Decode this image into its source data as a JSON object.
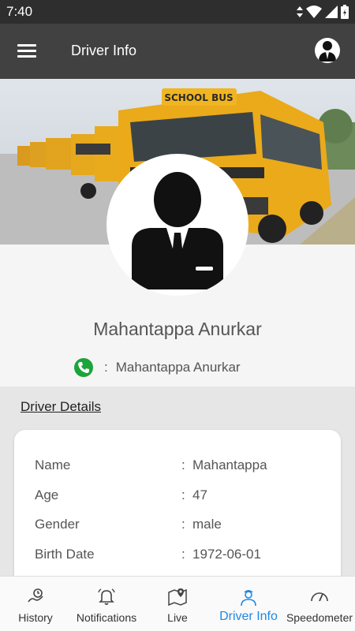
{
  "status_bar": {
    "time": "7:40",
    "icons": [
      "data-arrows-icon",
      "wifi-icon",
      "signal-icon",
      "battery-icon"
    ]
  },
  "appbar": {
    "title": "Driver Info",
    "menu_icon": "hamburger-menu-icon",
    "avatar_icon": "driver-avatar-icon"
  },
  "hero": {
    "bus_label": "SCHOOL BUS"
  },
  "profile": {
    "name": "Mahantappa Anurkar",
    "contact_separator": ":",
    "contact_name": "Mahantappa Anurkar",
    "phone_icon": "phone-icon"
  },
  "details": {
    "heading": "Driver Details",
    "rows": [
      {
        "label": "Name",
        "sep": ":",
        "value": "Mahantappa"
      },
      {
        "label": "Age",
        "sep": ":",
        "value": "47"
      },
      {
        "label": "Gender",
        "sep": ":",
        "value": "male"
      },
      {
        "label": "Birth Date",
        "sep": ":",
        "value": "1972-06-01"
      }
    ]
  },
  "bottom_nav": {
    "items": [
      {
        "label": "History",
        "icon": "history-icon",
        "active": false
      },
      {
        "label": "Notifications",
        "icon": "bell-icon",
        "active": false
      },
      {
        "label": "Live",
        "icon": "map-pin-icon",
        "active": false
      },
      {
        "label": "Driver Info",
        "icon": "driver-icon",
        "active": true
      },
      {
        "label": "Speedometer",
        "icon": "speedometer-icon",
        "active": false
      }
    ]
  },
  "colors": {
    "appbar": "#414141",
    "status_bar": "#2e2e2e",
    "accent": "#1e88e5",
    "phone_green": "#1ba43a",
    "bus_yellow": "#e8a91b"
  }
}
